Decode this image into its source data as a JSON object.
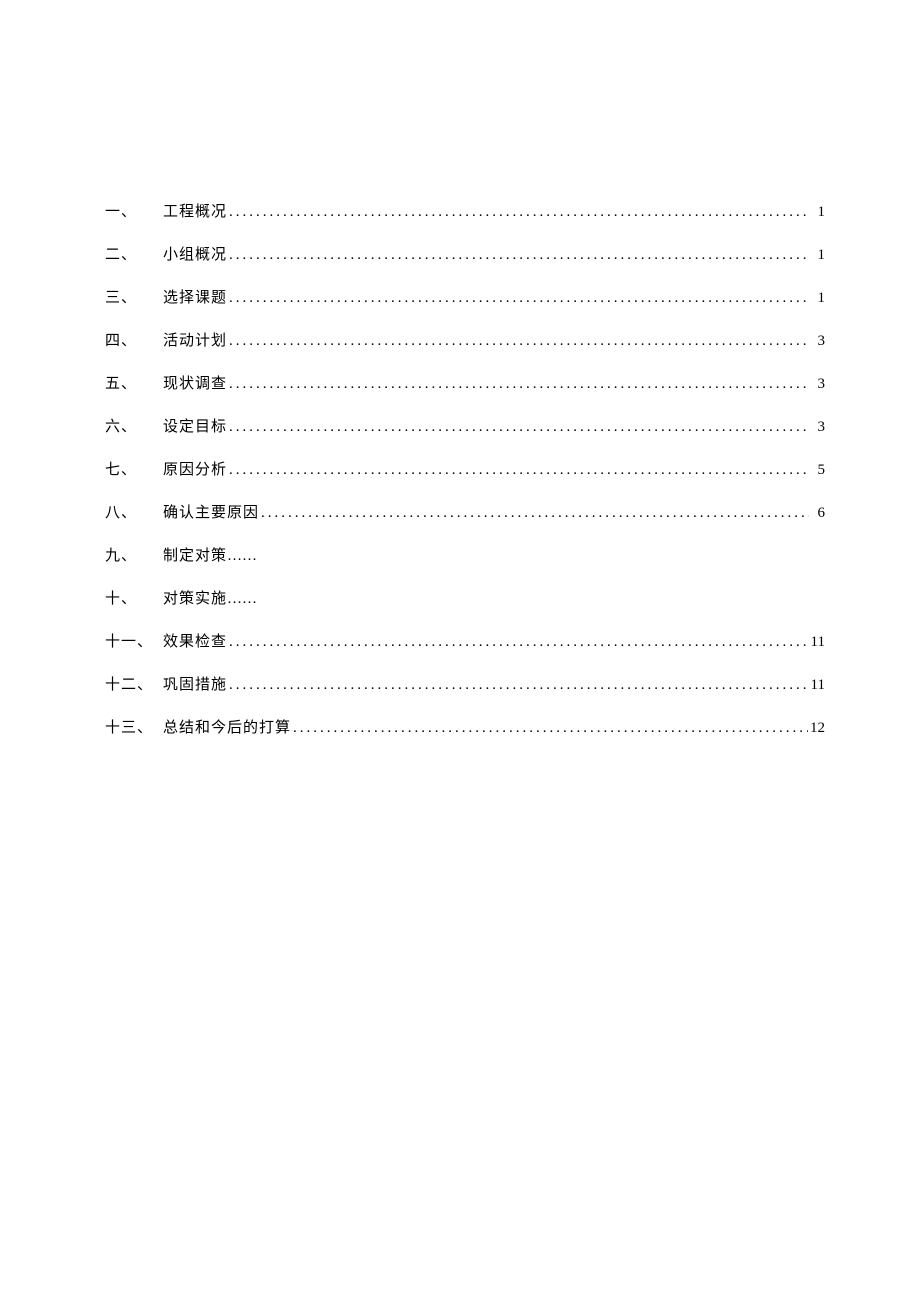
{
  "toc": [
    {
      "num": "一、",
      "title": "工程概况",
      "page": "1",
      "leader": true
    },
    {
      "num": "二、",
      "title": "小组概况",
      "page": "1",
      "leader": true
    },
    {
      "num": "三、",
      "title": "选择课题",
      "page": "1",
      "leader": true
    },
    {
      "num": "四、",
      "title": "活动计划",
      "page": "3",
      "leader": true
    },
    {
      "num": "五、",
      "title": "现状调查",
      "page": "3",
      "leader": true
    },
    {
      "num": "六、",
      "title": "设定目标",
      "page": "3",
      "leader": true
    },
    {
      "num": "七、",
      "title": "原因分析",
      "page": "5",
      "leader": true
    },
    {
      "num": "八、",
      "title": "确认主要原因",
      "page": "6",
      "leader": true
    },
    {
      "num": "九、",
      "title": "制定对策",
      "trail": "……",
      "page": "",
      "leader": false
    },
    {
      "num": "十、",
      "title": "对策实施",
      "trail": "……",
      "page": "",
      "leader": false
    },
    {
      "num": "十一、",
      "title": "效果检查",
      "page": "11",
      "leader": true,
      "wide": true
    },
    {
      "num": "十二、",
      "title": "巩固措施",
      "page": "11",
      "leader": true,
      "wide": true
    },
    {
      "num": "十三、",
      "title": "总结和今后的打算",
      "page": "12",
      "leader": true,
      "wide": true
    }
  ]
}
